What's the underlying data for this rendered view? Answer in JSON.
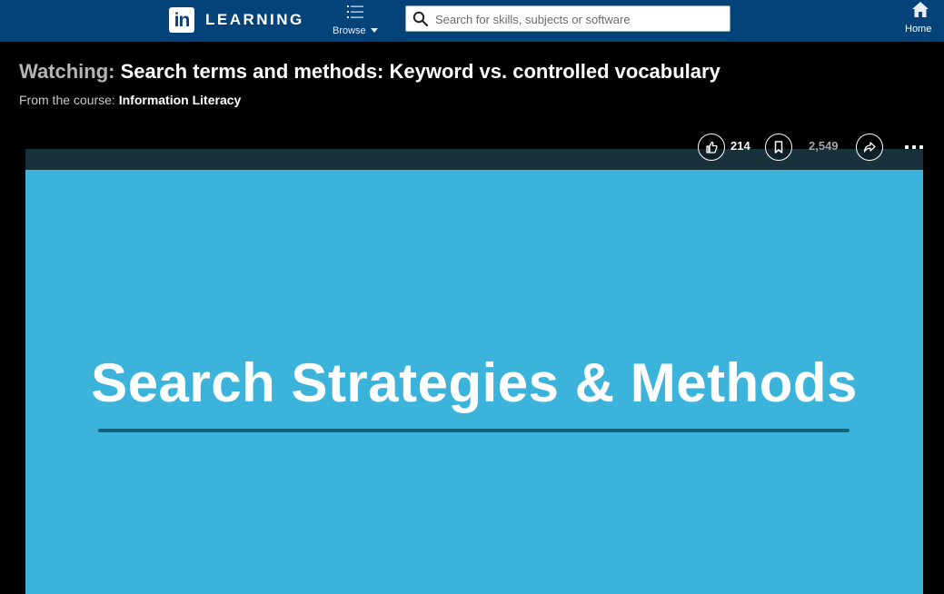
{
  "nav": {
    "logo_letters": "in",
    "brand": "LEARNING",
    "browse_label": "Browse",
    "search_placeholder": "Search for skills, subjects or software",
    "home_label": "Home",
    "colors": {
      "bar": "#03437a",
      "text": "#ffffff"
    }
  },
  "video": {
    "watching_prefix": "Watching:",
    "title": "Search terms and methods: Keyword vs. controlled vocabulary",
    "course_prefix": "From the course:",
    "course_name": "Information Literacy"
  },
  "actions": {
    "like_count": "214",
    "save_count": "2,549",
    "like_icon": "thumbs-up-icon",
    "save_icon": "bookmark-icon",
    "share_icon": "share-icon",
    "more_icon": "more-icon"
  },
  "slide": {
    "title": "Search Strategies & Methods",
    "background": "#3bb3db",
    "rule_color": "#15637e"
  }
}
